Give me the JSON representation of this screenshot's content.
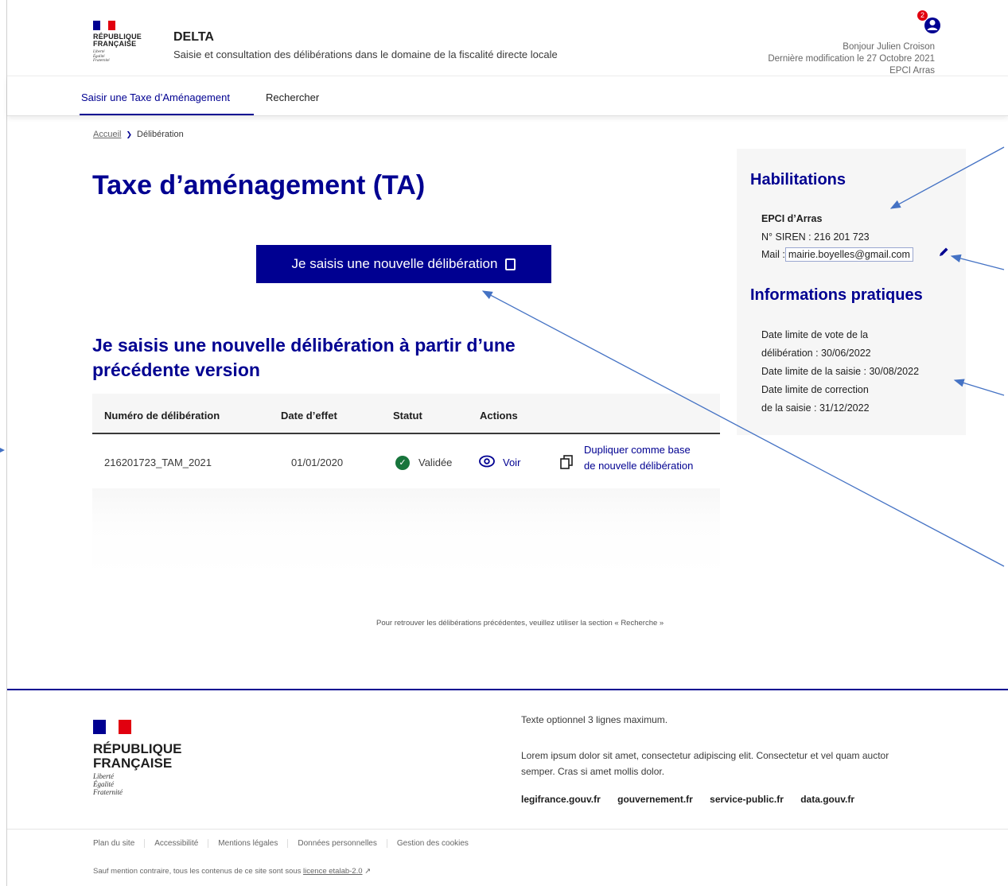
{
  "header": {
    "logo": {
      "line1": "RÉPUBLIQUE",
      "line2": "FRANÇAISE",
      "motto": [
        "Liberté",
        "Égalité",
        "Fraternité"
      ]
    },
    "app_title": "DELTA",
    "app_subtitle": "Saisie et consultation des délibérations dans le domaine de la fiscalité directe locale",
    "notification_count": "2",
    "user_greeting": "Bonjour Julien Croison",
    "last_modified": "Dernière modification le 27 Octobre 2021",
    "organization": "EPCI Arras"
  },
  "nav": {
    "items": [
      "Saisir une Taxe d’Aménagement",
      "Rechercher"
    ],
    "active": "Saisir une Taxe d’Aménagement"
  },
  "breadcrumb": {
    "home": "Accueil",
    "current": "Délibération"
  },
  "main": {
    "title": "Taxe d’aménagement (TA)",
    "primary_button": "Je saisis une nouvelle délibération",
    "section_title": "Je saisis une nouvelle délibération à partir d’une précédente version",
    "table": {
      "headers": [
        "Numéro de délibération",
        "Date d’effet",
        "Statut",
        "Actions"
      ],
      "rows": [
        {
          "numero": "216201723_TAM_2021",
          "date": "01/01/2020",
          "statut": "Validée",
          "view": "Voir",
          "duplicate": [
            "Dupliquer comme base",
            "de nouvelle délibération"
          ]
        }
      ]
    },
    "hint": "Pour retrouver les délibérations précédentes, veuillez utiliser la section « Recherche »"
  },
  "sidebar": {
    "habilitations_title": "Habilitations",
    "org_name": "EPCI d’Arras",
    "siren": "N° SIREN : 216 201 723",
    "mail_label": "Mail :",
    "mail_value": "mairie.boyelles@gmail.com",
    "info_title": "Informations pratiques",
    "info_lines": [
      "Date limite de vote de la",
      "délibération : 30/06/2022",
      "Date limite de la saisie : 30/08/2022",
      "Date limite de correction",
      "de la saisie  : 31/12/2022"
    ]
  },
  "footer": {
    "logo": {
      "line1": "RÉPUBLIQUE",
      "line2": "FRANÇAISE",
      "motto": [
        "Liberté",
        "Égalité",
        "Fraternité"
      ]
    },
    "optional_text": "Texte optionnel 3 lignes maximum.",
    "lorem": "Lorem ipsum dolor sit amet, consectetur adipiscing elit. Consectetur et vel quam auctor semper. Cras si amet mollis dolor.",
    "links": [
      "legifrance.gouv.fr",
      "gouvernement.fr",
      "service-public.fr",
      "data.gouv.fr"
    ],
    "bottom_links": [
      "Plan du site",
      "Accessibilité",
      "Mentions légales",
      "Données personnelles",
      "Gestion des cookies"
    ],
    "license_prefix": "Sauf mention contraire, tous les contenus de ce site sont sous",
    "license_link": "licence etalab-2.0"
  },
  "colors": {
    "primary": "#000091",
    "success": "#18753c",
    "marianne_red": "#e1000f",
    "annotation": "#4472c4"
  },
  "icons": [
    "user-icon",
    "copy-icon",
    "check-circle-icon",
    "eye-icon",
    "duplicate-icon",
    "pencil-icon",
    "external-link-icon"
  ]
}
